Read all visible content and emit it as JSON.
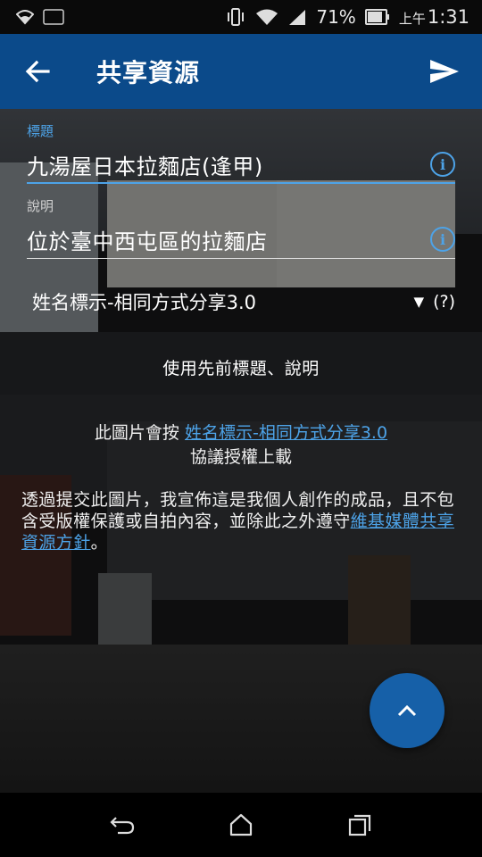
{
  "status_bar": {
    "battery_percent_text": "71%",
    "notification_badge": "71",
    "ampm": "上午",
    "time": "1:31"
  },
  "app_bar": {
    "title": "共享資源"
  },
  "form": {
    "title_label": "標題",
    "title_value": "九湯屋日本拉麵店(逢甲)",
    "description_label": "說明",
    "description_value": "位於臺中西屯區的拉麵店",
    "license_selected": "姓名標示-相同方式分享3.0",
    "license_help": "(?)",
    "use_previous_button": "使用先前標題、說明"
  },
  "license_note": {
    "prefix": "此圖片會按",
    "link": "姓名標示-相同方式分享3.0",
    "suffix": "協議授權上載"
  },
  "declaration": {
    "text": "透過提交此圖片，我宣佈這是我個人創作的成品，且不包含受版權保護或自拍內容，並除此之外遵守",
    "link": "維基媒體共享資源方針",
    "end": "。"
  },
  "colors": {
    "app_bar": "#0b4a8a",
    "accent": "#4da3e8",
    "fab": "#1660a8"
  },
  "icons": {
    "back": "arrow-left",
    "send": "paper-plane",
    "info": "info-circle",
    "fab": "chevron-up",
    "nav_back": "return-arrow",
    "nav_home": "house",
    "nav_recents": "overlapping-squares"
  }
}
